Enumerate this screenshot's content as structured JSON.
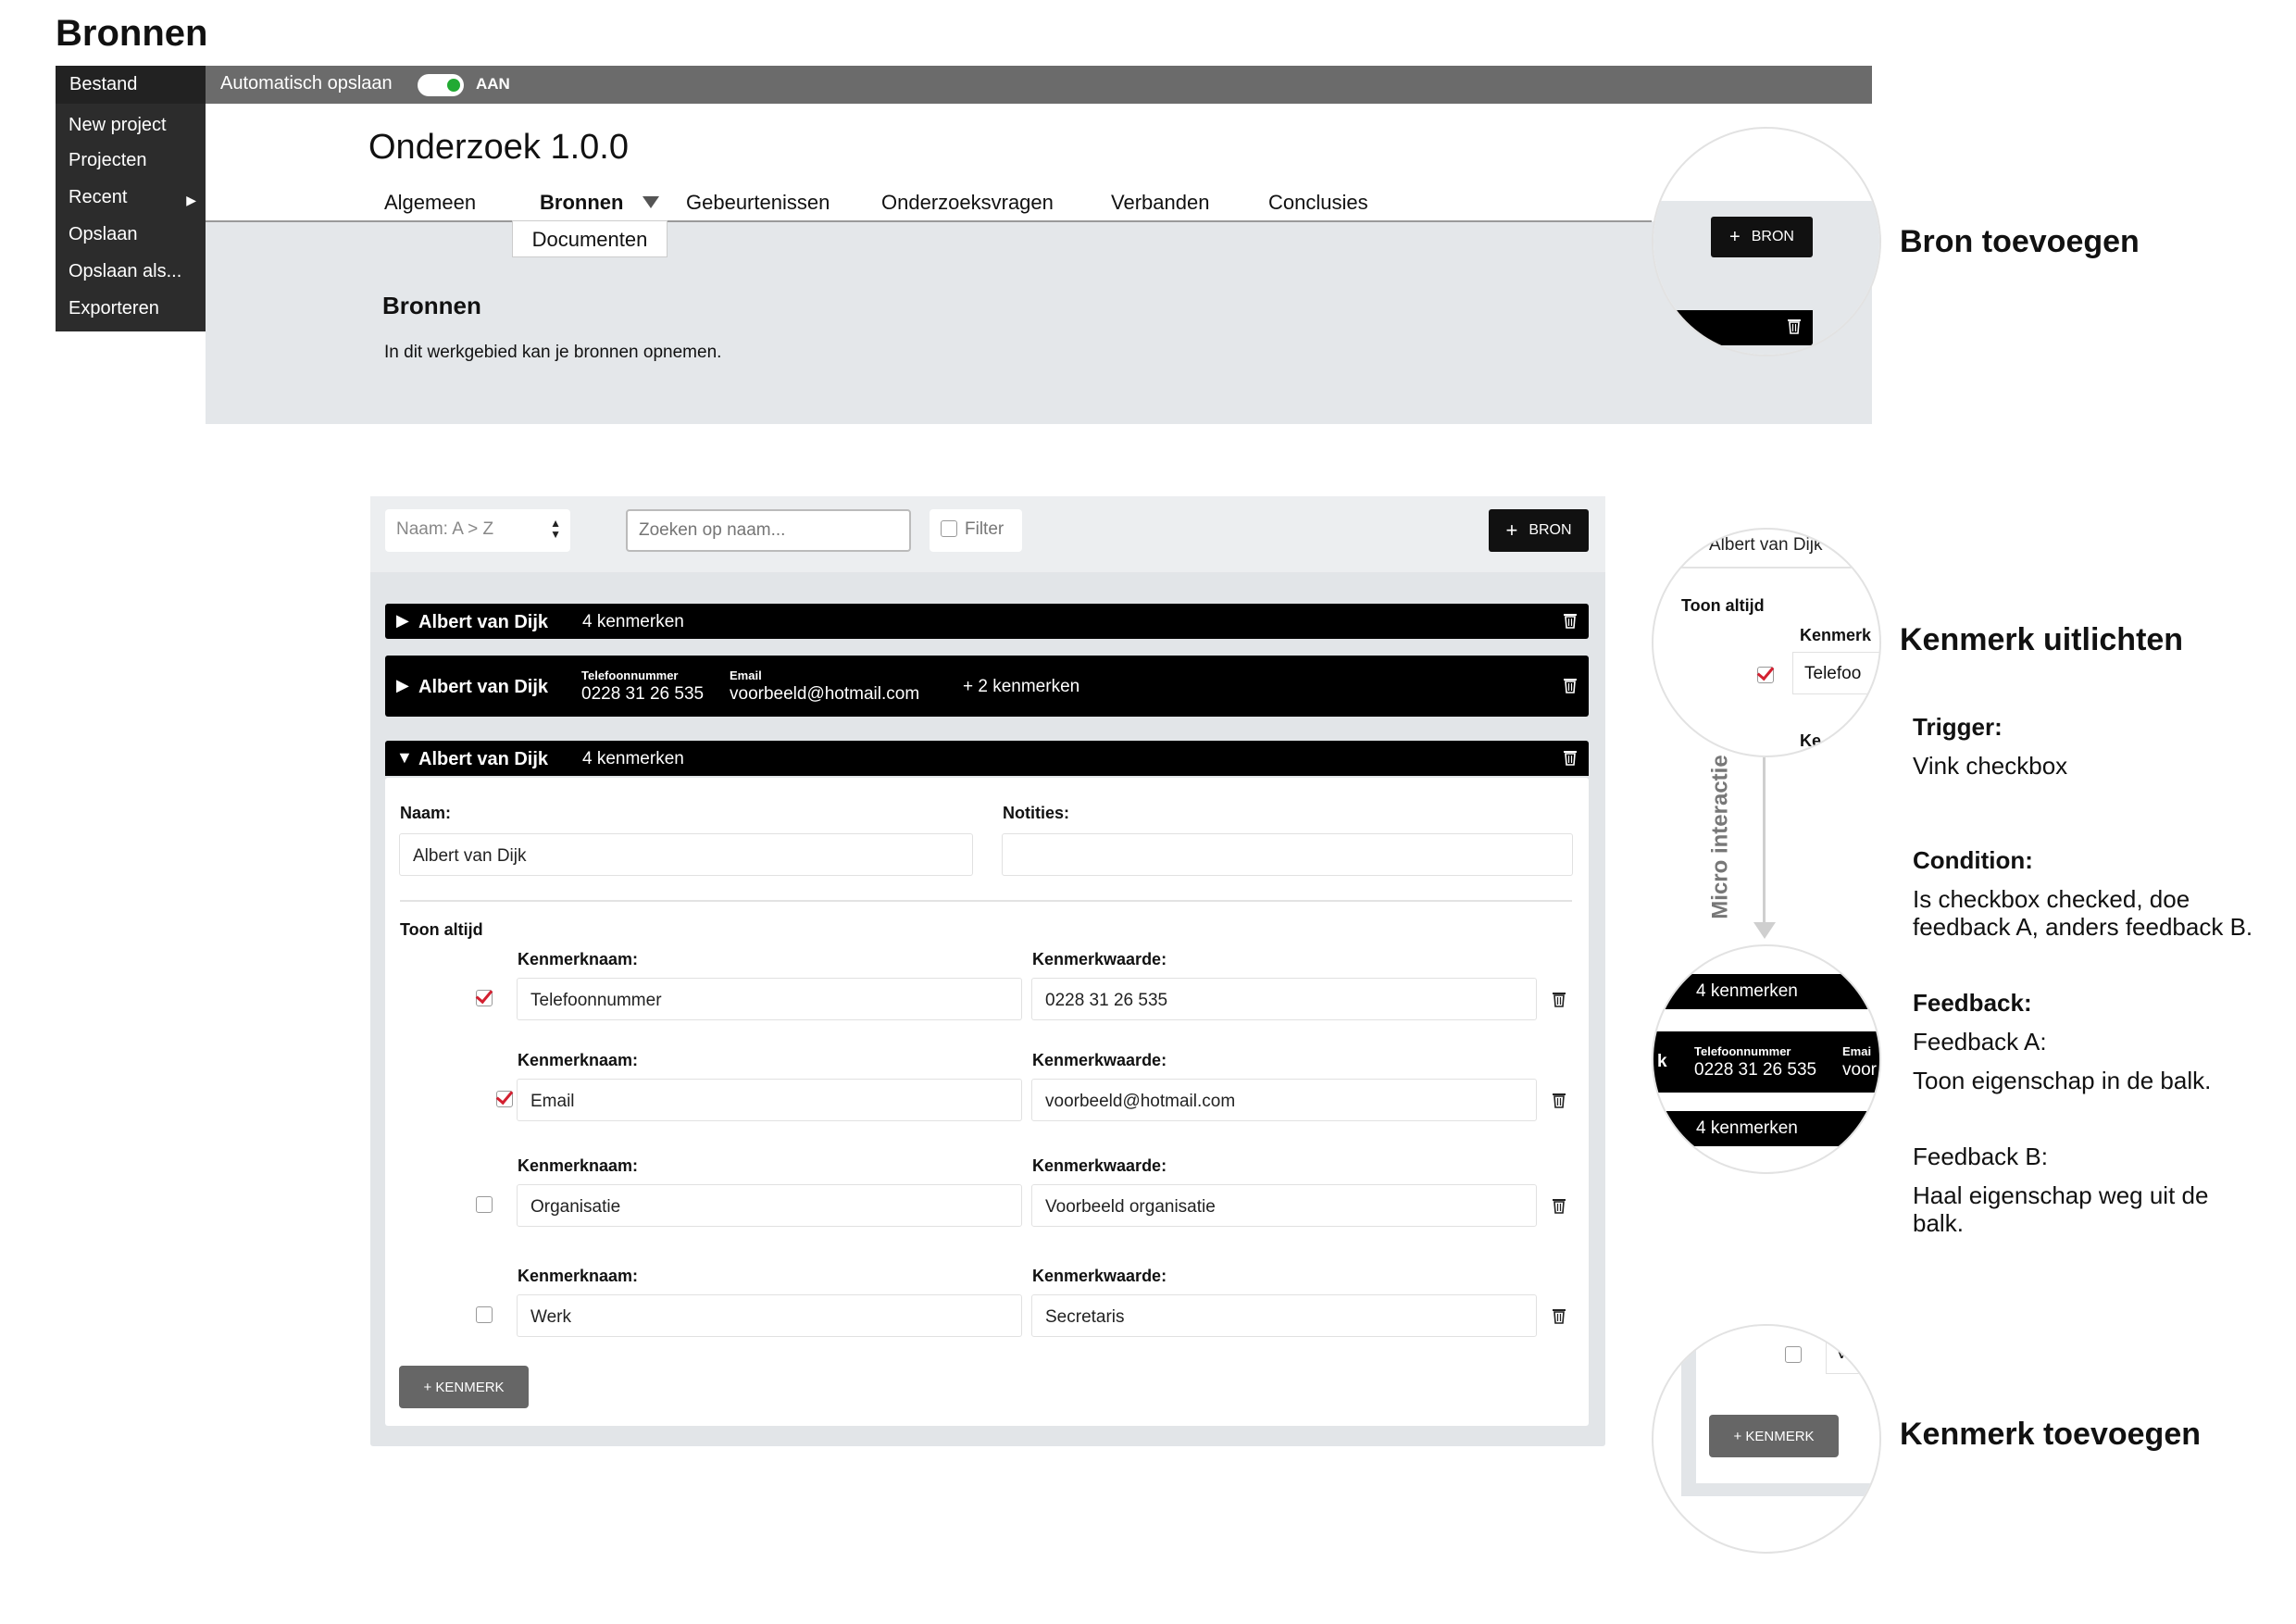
{
  "page": {
    "title": "Bronnen"
  },
  "topbar": {
    "file_label": "Bestand",
    "autosave_label": "Automatisch opslaan",
    "autosave_state": "AAN"
  },
  "file_menu": {
    "items": [
      "New project",
      "Projecten",
      "Recent",
      "Opslaan",
      "Opslaan als...",
      "Exporteren"
    ]
  },
  "app": {
    "title": "Onderzoek 1.0.0"
  },
  "tabs": [
    "Algemeen",
    "Bronnen",
    "Gebeurtenissen",
    "Onderzoeksvragen",
    "Verbanden",
    "Conclusies"
  ],
  "submenu": {
    "item": "Documenten"
  },
  "section": {
    "title": "Bronnen",
    "description": "In dit werkgebied kan je bronnen opnemen."
  },
  "zoom1": {
    "button_label": "BRON"
  },
  "annotations": {
    "bron_toevoegen": "Bron toevoegen",
    "kenmerk_uitlichten": "Kenmerk uitlichten",
    "trigger_label": "Trigger:",
    "trigger_text": "Vink checkbox",
    "condition_label": "Condition:",
    "condition_line1": "Is checkbox checked, doe",
    "condition_line2": "feedback A, anders feedback B.",
    "feedback_label": "Feedback:",
    "feedback_a_label": "Feedback A:",
    "feedback_a_text": "Toon eigenschap in de balk.",
    "feedback_b_label": "Feedback B:",
    "feedback_b_line1": "Haal eigenschap weg uit de",
    "feedback_b_line2": "balk.",
    "kenmerk_toevoegen": "Kenmerk toevoegen",
    "micro_interactie": "Micro interactie"
  },
  "toolbar": {
    "sort_value": "Naam: A > Z",
    "search_placeholder": "Zoeken op naam...",
    "filter_label": "Filter",
    "add_button": "BRON"
  },
  "sources": [
    {
      "name": "Albert van Dijk",
      "count": "4 kenmerken"
    },
    {
      "name": "Albert van Dijk",
      "tel_label": "Telefoonnummer",
      "tel_value": "0228 31 26 535",
      "email_label": "Email",
      "email_value": "voorbeeld@hotmail.com",
      "extra": "+ 2 kenmerken"
    },
    {
      "name": "Albert van Dijk",
      "count": "4 kenmerken"
    }
  ],
  "detail": {
    "naam_label": "Naam:",
    "naam_value": "Albert van Dijk",
    "notities_label": "Notities:",
    "notities_value": "",
    "toon_altijd": "Toon altijd",
    "kenmerk_name_label": "Kenmerknaam:",
    "kenmerk_value_label": "Kenmerkwaarde:",
    "kenmerken": [
      {
        "name": "Telefoonnummer",
        "value": "0228 31 26 535",
        "checked": true
      },
      {
        "name": "Email",
        "value": "voorbeeld@hotmail.com",
        "checked": true
      },
      {
        "name": "Organisatie",
        "value": "Voorbeeld organisatie",
        "checked": false
      },
      {
        "name": "Werk",
        "value": "Secretaris",
        "checked": false
      }
    ],
    "add_kenmerk": "+ KENMERK"
  },
  "zoom2": {
    "top_text": "Albert van Dijk",
    "toon_altijd": "Toon altijd",
    "kenmerk": "Kenmerk",
    "field_value": "Telefoo",
    "ke": "Ke"
  },
  "zoom3": {
    "count_top": "4 kenmerken",
    "k": "k",
    "tel_label": "Telefoonnummer",
    "tel_value": "0228 31 26 535",
    "email_label": "Emai",
    "email_value": "voor",
    "count_bottom": "4 kenmerken"
  },
  "zoom4": {
    "add_kenmerk": "+ KENMERK",
    "v": "V"
  }
}
